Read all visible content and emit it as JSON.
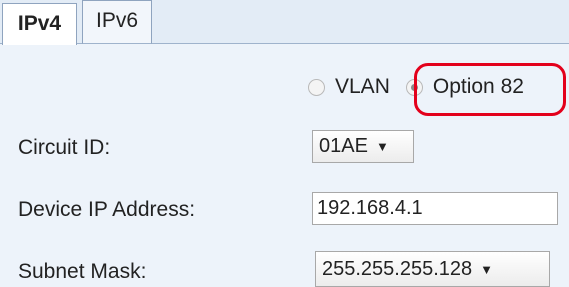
{
  "tabs": [
    {
      "label": "IPv4",
      "active": true
    },
    {
      "label": "IPv6",
      "active": false
    }
  ],
  "relay": {
    "options": [
      {
        "label": "VLAN",
        "selected": false
      },
      {
        "label": "Option 82",
        "selected": true
      }
    ],
    "highlight_color": "#e3001b"
  },
  "fields": {
    "circuit_id": {
      "label": "Circuit ID:",
      "value": "01AE"
    },
    "device_ip": {
      "label": "Device IP Address:",
      "value": "192.168.4.1"
    },
    "subnet_mask": {
      "label": "Subnet Mask:",
      "value": "255.255.255.128"
    }
  },
  "icons": {
    "dropdown": "▼"
  }
}
